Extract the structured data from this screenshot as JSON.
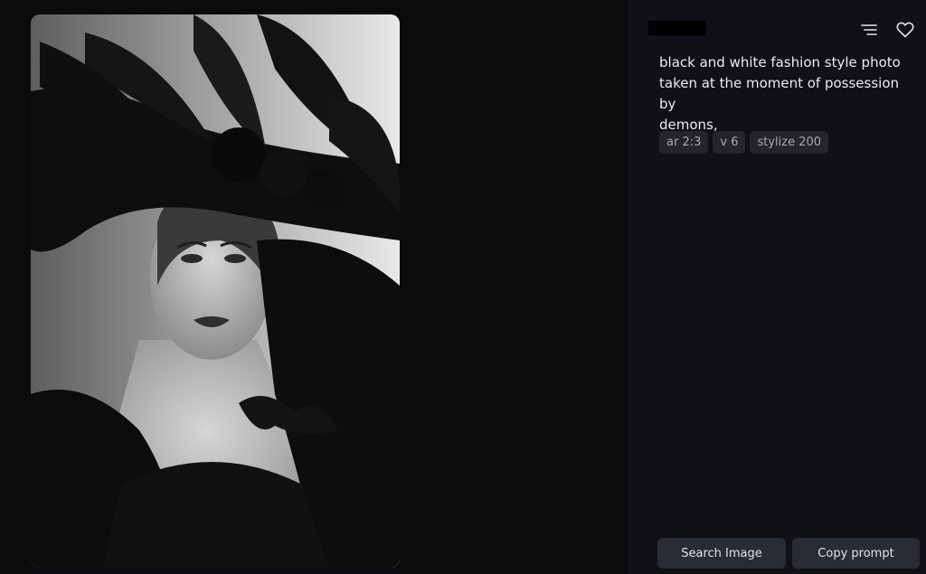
{
  "prompt": {
    "line1": "black and white fashion style photo",
    "line2": "taken at the moment of possession by",
    "line3": "demons,"
  },
  "tags": [
    "ar 2:3",
    "v 6",
    "stylize 200"
  ],
  "actions": {
    "search_label": "Search Image",
    "copy_label": "Copy prompt"
  },
  "icons": {
    "menu": "menu-lines-icon",
    "favorite": "heart-outline-icon"
  },
  "colors": {
    "background": "#0b0b0d",
    "panel": "#101116",
    "tag_bg": "#23252b",
    "button_bg": "#2a2c33"
  }
}
